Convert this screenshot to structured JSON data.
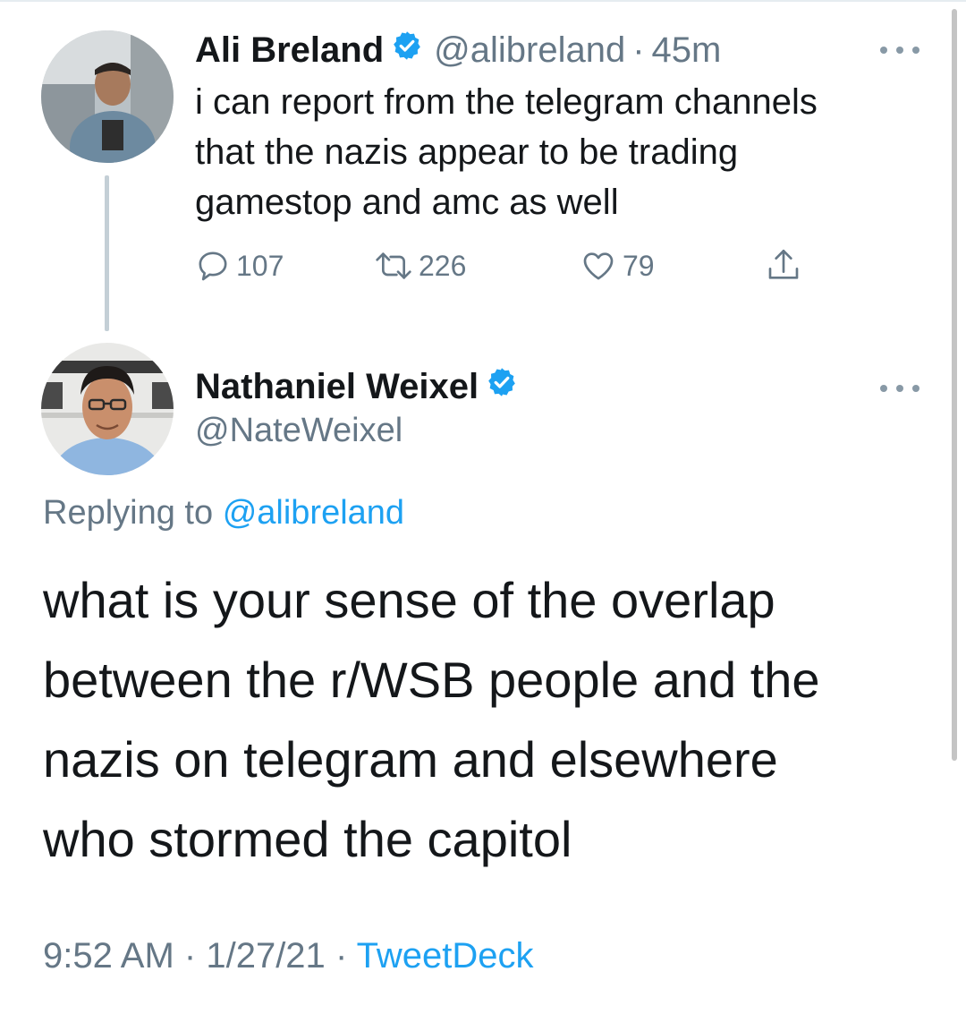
{
  "tweet_1": {
    "name": "Ali Breland",
    "handle": "@alibreland",
    "separator": "·",
    "time": "45m",
    "text_lines": [
      "i can report from the telegram channels",
      "that the nazis appear to be trading",
      "gamestop and amc as well"
    ],
    "actions": {
      "reply_count": "107",
      "retweet_count": "226",
      "like_count": "79"
    }
  },
  "tweet_2": {
    "name": "Nathaniel Weixel",
    "handle": "@NateWeixel",
    "replying_prefix": "Replying to",
    "replying_handle": "@alibreland",
    "text_lines": [
      "what is your sense of the overlap",
      "between the r/WSB people and the",
      "nazis on telegram and elsewhere",
      "who stormed the capitol"
    ],
    "time": "9:52 AM",
    "separator": "·",
    "date": "1/27/21",
    "source": "TweetDeck"
  },
  "icons": {
    "verified": "verified-badge-icon",
    "more": "more-dots-icon",
    "reply": "reply-bubble-icon",
    "retweet": "retweet-icon",
    "like": "heart-icon",
    "share": "share-icon"
  },
  "colors": {
    "accent": "#1da1f2",
    "secondary_text": "#657786",
    "primary_text": "#14171a",
    "thread_line": "#c4cfd6"
  }
}
